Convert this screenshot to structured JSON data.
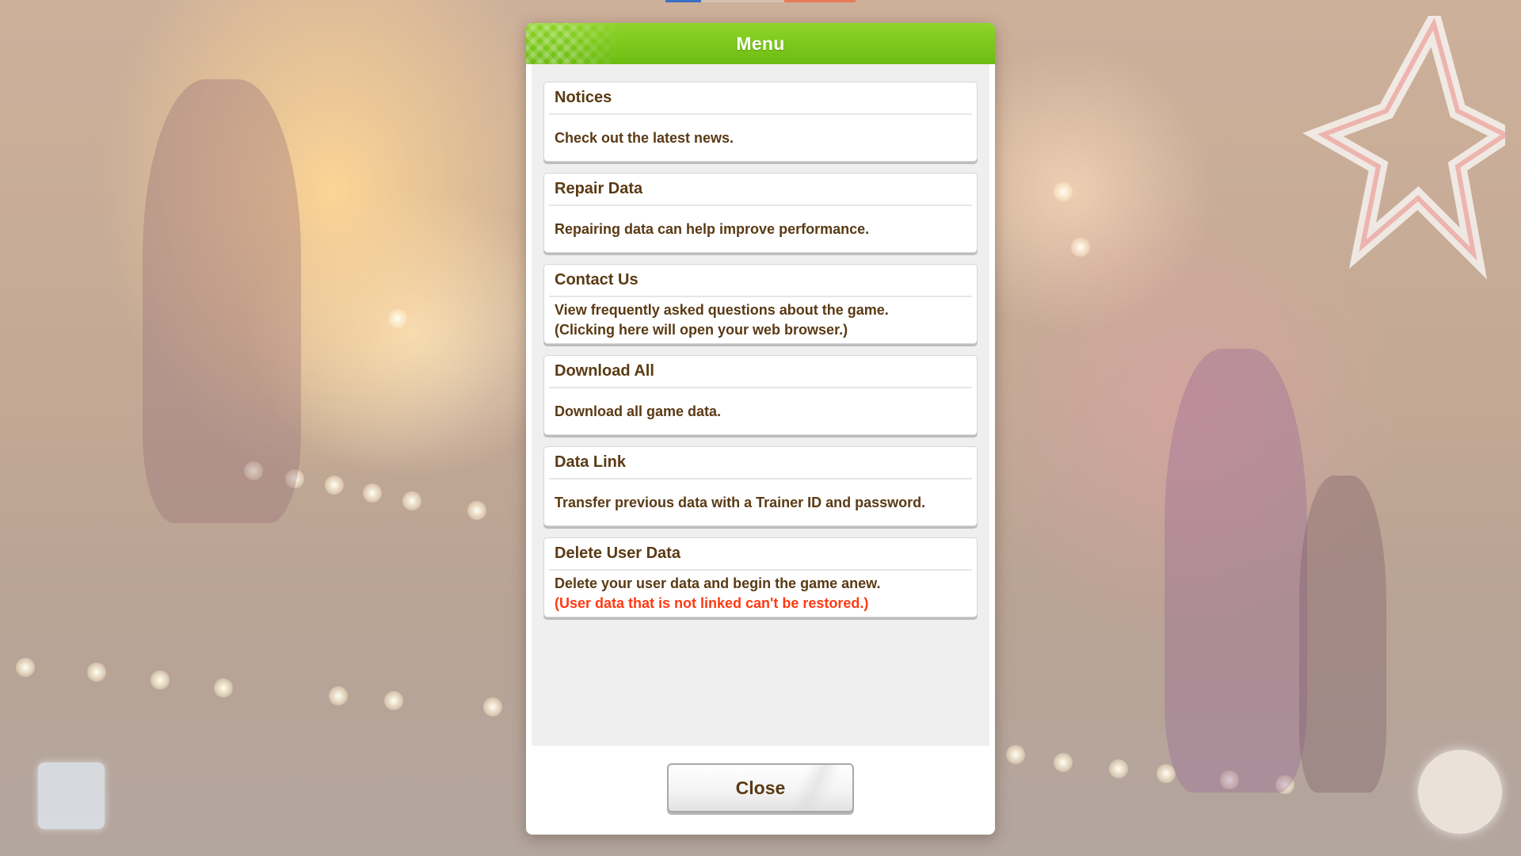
{
  "dialog": {
    "title": "Menu",
    "close_label": "Close"
  },
  "menu": {
    "items": [
      {
        "title": "Notices",
        "desc_lines": [
          "Check out the latest news."
        ]
      },
      {
        "title": "Repair Data",
        "desc_lines": [
          "Repairing data can help improve performance."
        ]
      },
      {
        "title": "Contact Us",
        "desc_lines": [
          "View frequently asked questions about the game.",
          "(Clicking here will open your web browser.)"
        ]
      },
      {
        "title": "Download All",
        "desc_lines": [
          "Download all game data."
        ]
      },
      {
        "title": "Data Link",
        "desc_lines": [
          "Transfer previous data with a Trainer ID and password."
        ]
      },
      {
        "title": "Delete User Data",
        "desc_lines": [
          "Delete your user data and begin the game anew."
        ],
        "warning": "(User data that is not linked can't be restored.)"
      }
    ]
  },
  "colors": {
    "header_green": "#7cc81e",
    "text_brown": "#5a3a14",
    "warning_red": "#ff3a12"
  }
}
